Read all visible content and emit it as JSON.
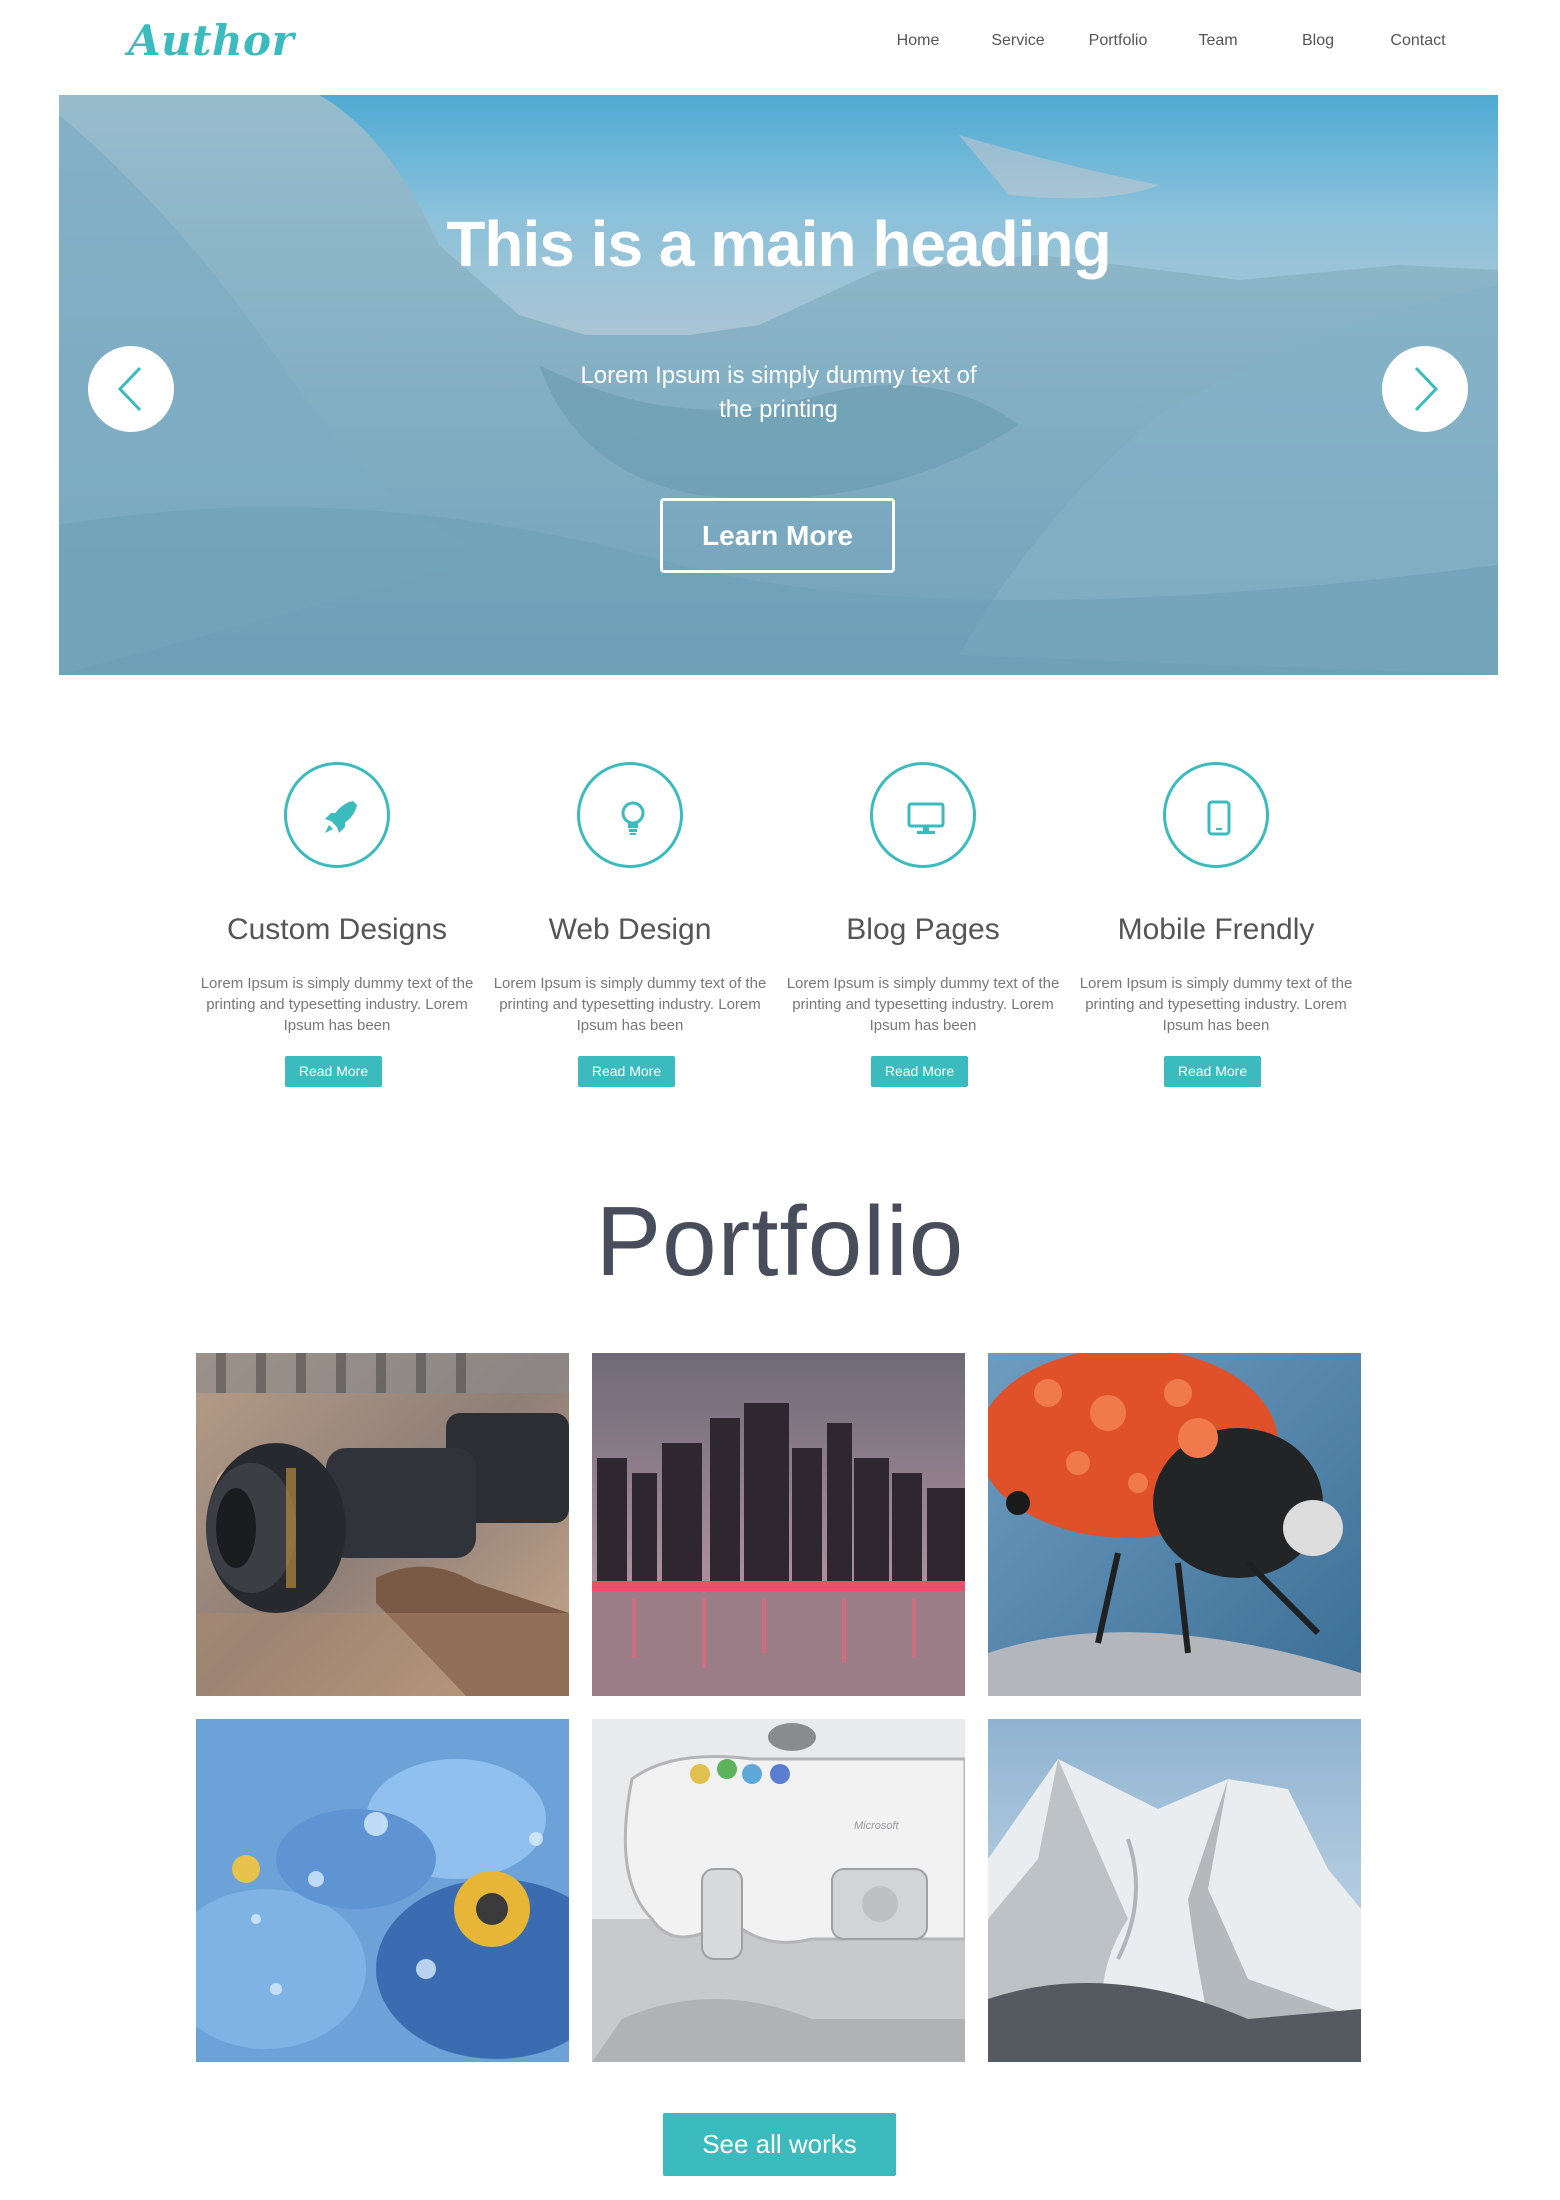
{
  "header": {
    "logo": "Author",
    "nav": [
      "Home",
      "Service",
      "Portfolio",
      "Team",
      "Blog",
      "Contact"
    ]
  },
  "hero": {
    "title": "This is a main heading",
    "subtitle": "Lorem Ipsum is simply dummy text of the printing",
    "button_label": "Learn More",
    "prev_icon": "chevron-left-icon",
    "next_icon": "chevron-right-icon"
  },
  "features": [
    {
      "icon": "rocket-icon",
      "title": "Custom Designs",
      "text": "Lorem Ipsum is simply dummy text of the printing and typesetting industry. Lorem Ipsum has been",
      "button": "Read More"
    },
    {
      "icon": "lightbulb-icon",
      "title": "Web Design",
      "text": "Lorem Ipsum is simply dummy text of the printing and typesetting industry. Lorem Ipsum has been",
      "button": "Read More"
    },
    {
      "icon": "monitor-icon",
      "title": "Blog Pages",
      "text": "Lorem Ipsum is simply dummy text of the printing and typesetting industry. Lorem Ipsum has been",
      "button": "Read More"
    },
    {
      "icon": "tablet-icon",
      "title": "Mobile Frendly",
      "text": "Lorem Ipsum is simply dummy text of the printing and typesetting industry. Lorem Ipsum has been",
      "button": "Read More"
    }
  ],
  "portfolio": {
    "title": "Portfolio",
    "items": [
      "camera-photo",
      "city-skyline-photo",
      "ladybug-photo",
      "blue-flower-photo",
      "game-controller-photo",
      "snowy-mountain-photo"
    ],
    "controller_brand": "Microsoft",
    "see_all_label": "See all works"
  },
  "colors": {
    "accent": "#3bbbbd",
    "heading": "#474d5a",
    "text": "#555555"
  }
}
